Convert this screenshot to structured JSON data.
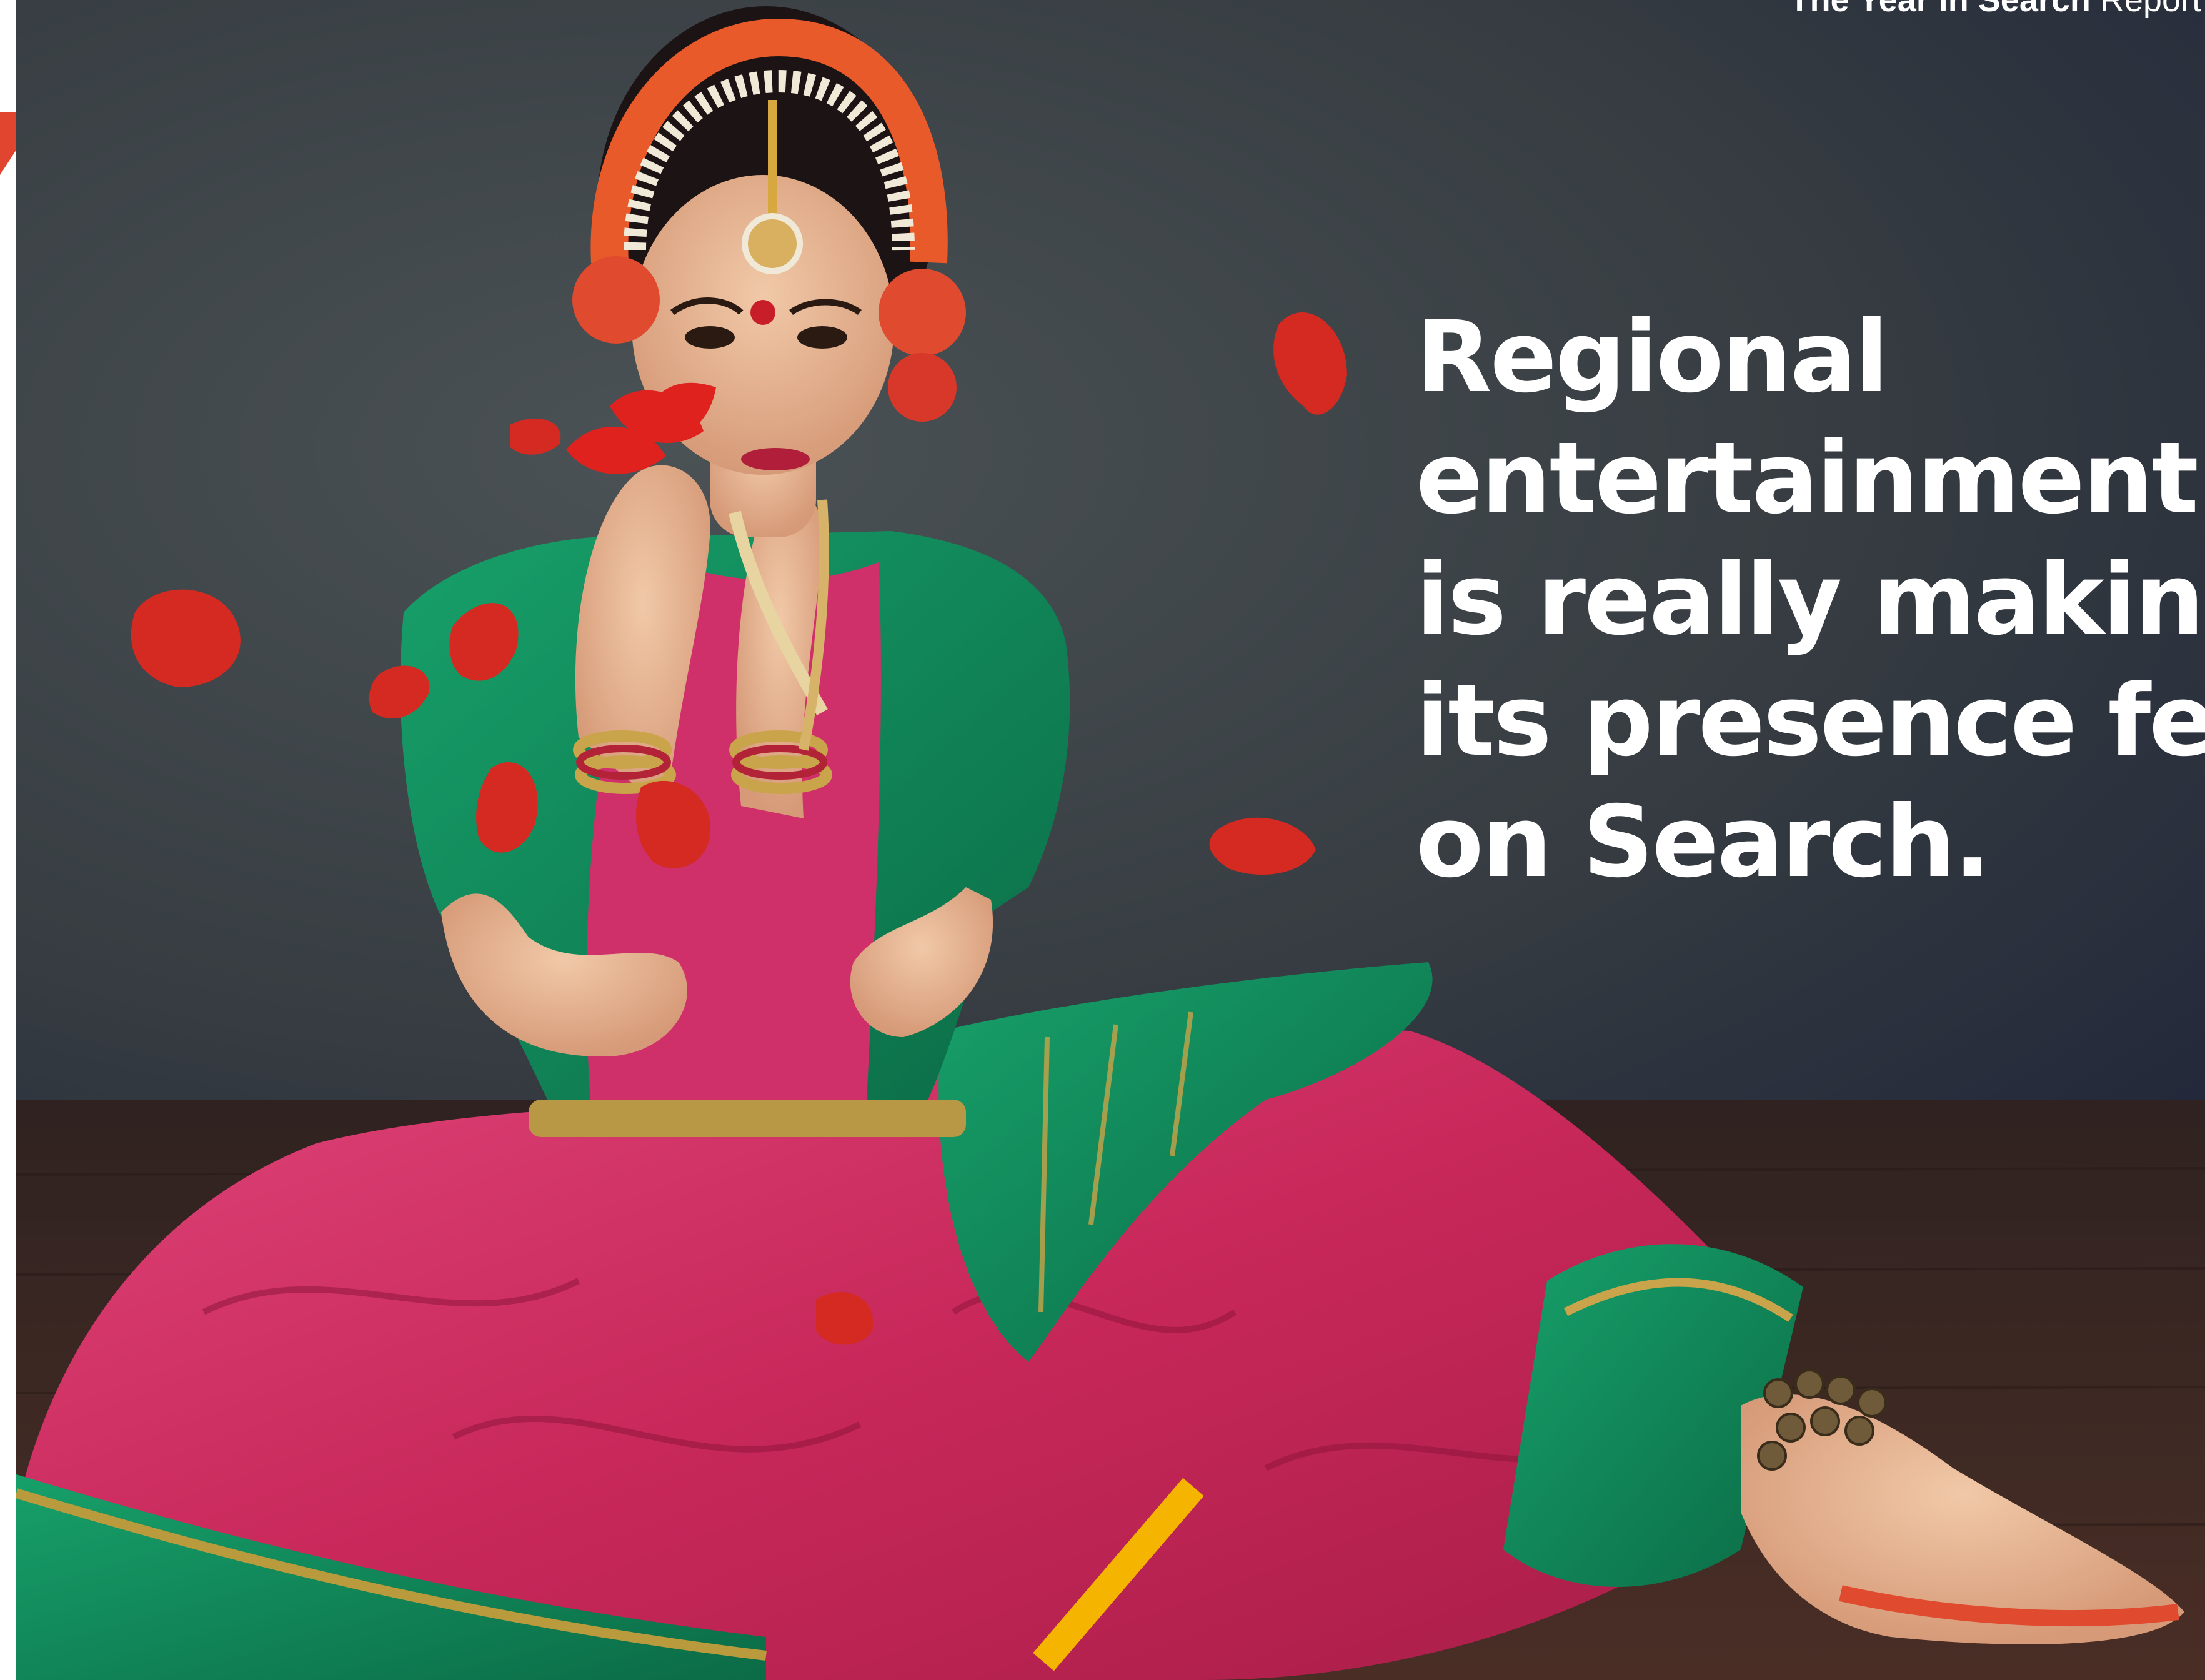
{
  "header": {
    "title_bold": "The Year in Search",
    "title_light": "Report"
  },
  "headline": {
    "lines": [
      "Regional",
      "entertainment",
      "is really making",
      "its presence felt",
      "on Search."
    ]
  },
  "colors": {
    "background_wall": "#3c4246",
    "floor": "#3a2620",
    "accent_red": "#e2452f",
    "accent_yellow": "#f5b400",
    "saree_pink": "#d02e63",
    "saree_green": "#0f8c5c",
    "text": "#ffffff"
  }
}
